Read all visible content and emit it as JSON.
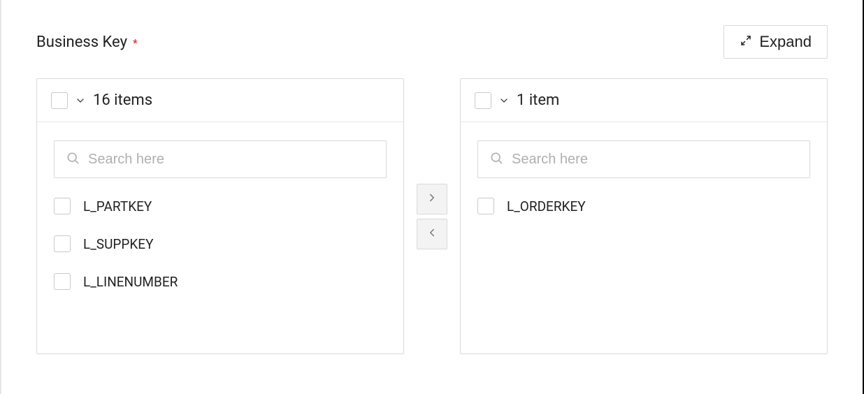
{
  "label": "Business Key",
  "required_mark": "*",
  "expand_label": "Expand",
  "search_placeholder": "Search here",
  "left_panel": {
    "count_label": "16 items",
    "items": [
      {
        "label": "L_PARTKEY"
      },
      {
        "label": "L_SUPPKEY"
      },
      {
        "label": "L_LINENUMBER"
      }
    ]
  },
  "right_panel": {
    "count_label": "1 item",
    "items": [
      {
        "label": "L_ORDERKEY"
      }
    ]
  }
}
